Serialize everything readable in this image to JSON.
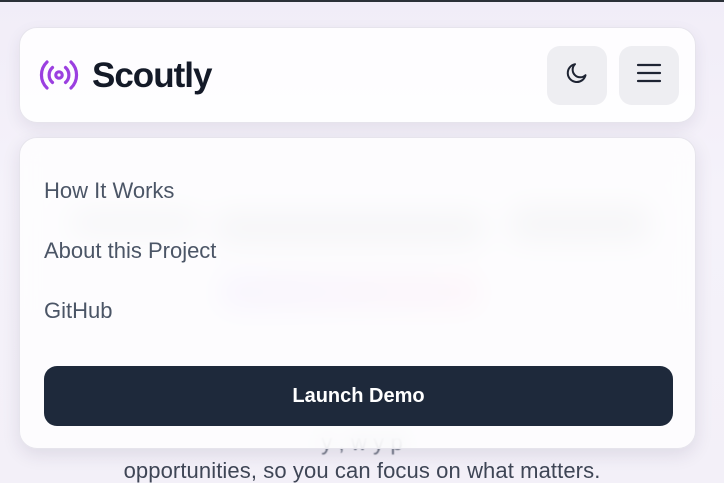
{
  "header": {
    "brand": "Scoutly",
    "logo_icon": "radio-broadcast-icon",
    "theme_toggle_icon": "moon-icon",
    "menu_toggle_icon": "hamburger-menu-icon",
    "accent_color": "#9b3fe0"
  },
  "menu": {
    "items": [
      {
        "label": "How It Works"
      },
      {
        "label": "About this Project"
      },
      {
        "label": "GitHub"
      }
    ],
    "cta_label": "Launch Demo"
  },
  "background": {
    "partial_line": "y , w               y                     p",
    "line": "opportunities, so you can focus on what matters."
  }
}
